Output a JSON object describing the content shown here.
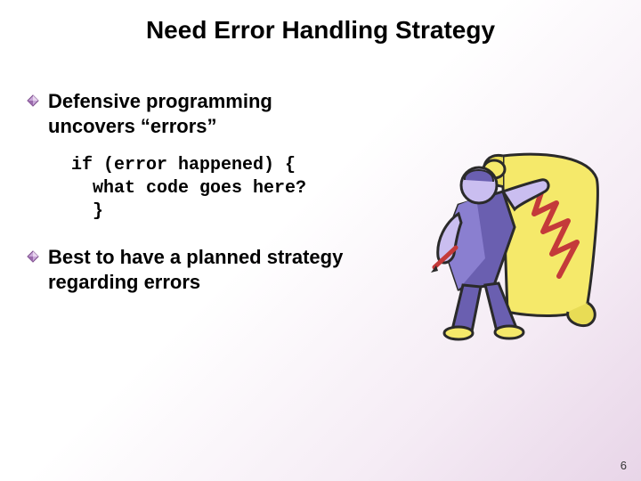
{
  "title": "Need Error Handling Strategy",
  "bullets": [
    {
      "text": "Defensive programming uncovers “errors”"
    },
    {
      "text": "Best to have a planned strategy regarding errors"
    }
  ],
  "code": "if (error happened) {\n  what code goes here?\n  }",
  "pageNumber": "6"
}
